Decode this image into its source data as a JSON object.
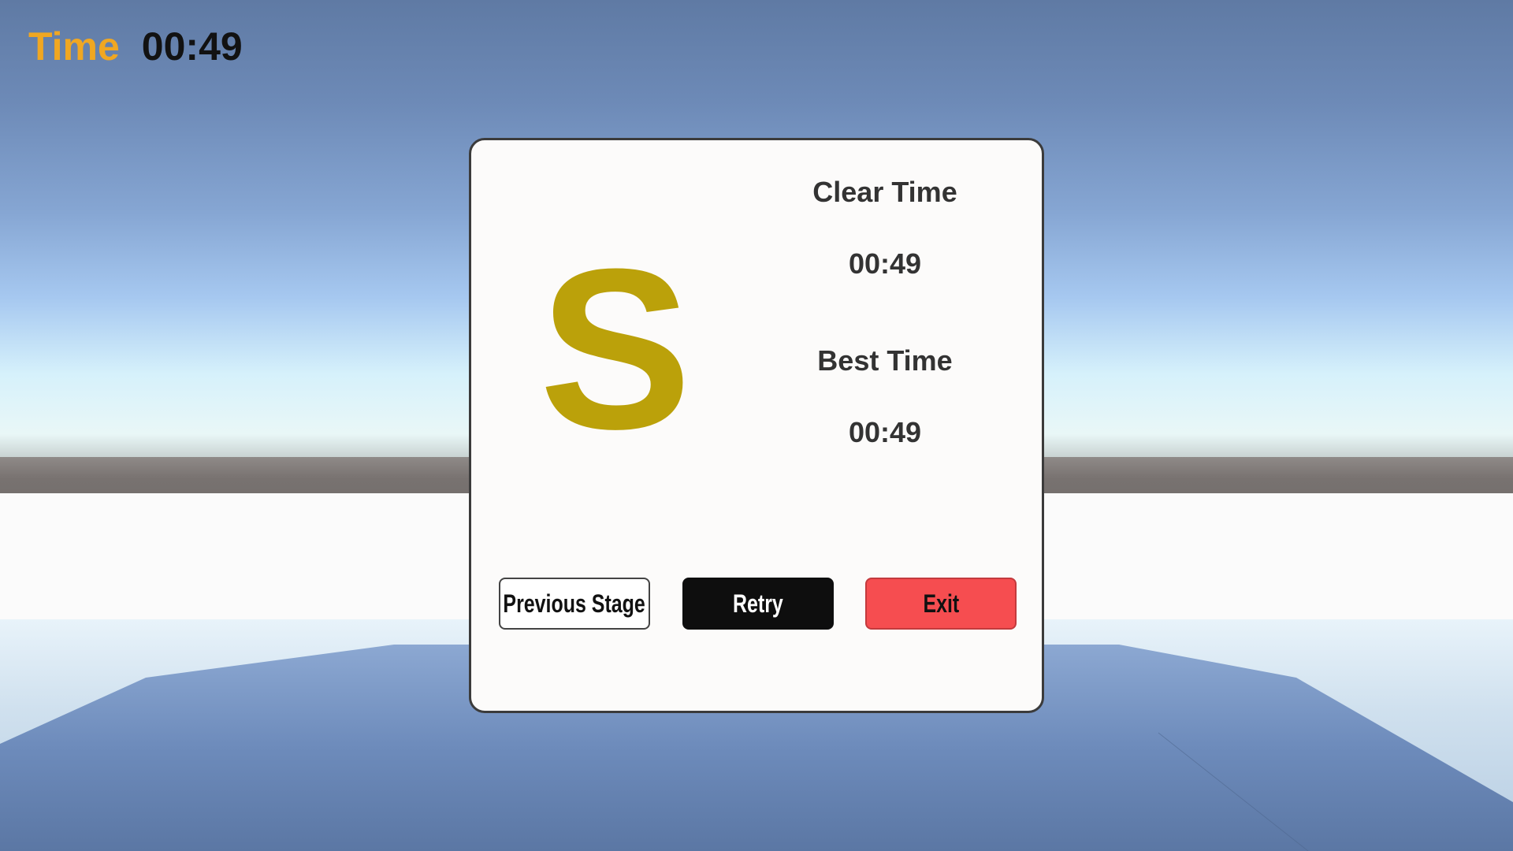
{
  "hud": {
    "time_label": "Time",
    "time_value": "00:49"
  },
  "result": {
    "rank": "S",
    "clear_time_label": "Clear Time",
    "clear_time_value": "00:49",
    "best_time_label": "Best Time",
    "best_time_value": "00:49"
  },
  "buttons": {
    "previous_stage": "Previous Stage",
    "retry": "Retry",
    "exit": "Exit"
  },
  "colors": {
    "hud_label": "#f0a722",
    "rank_letter": "#bba10a",
    "exit_button": "#f64d50",
    "retry_button": "#0e0e0e"
  }
}
